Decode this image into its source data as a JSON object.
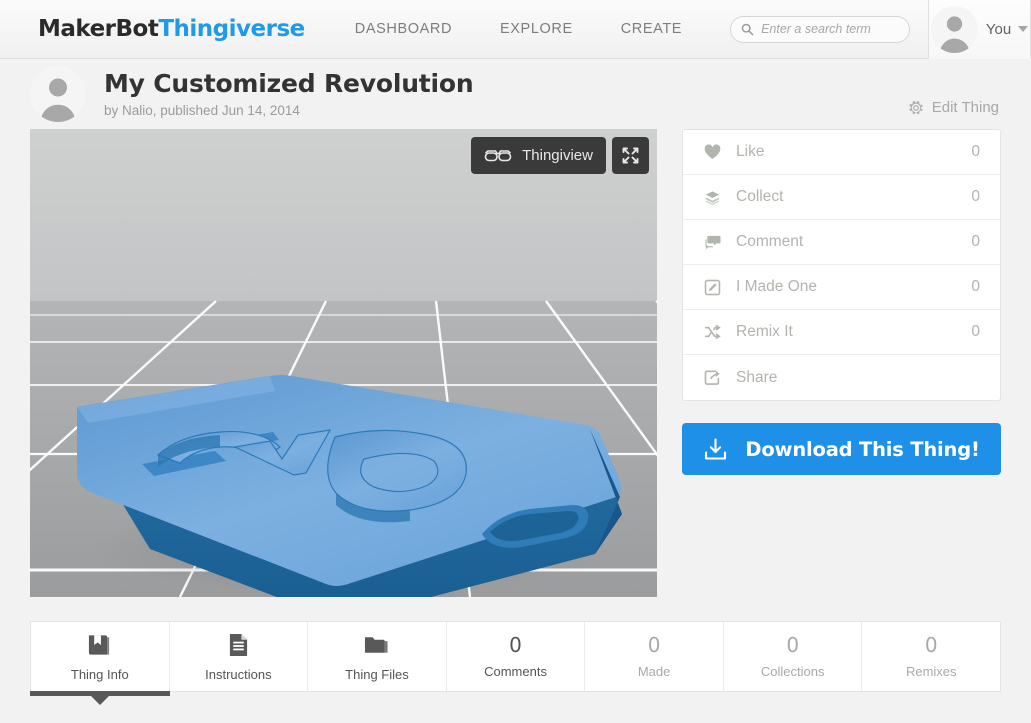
{
  "header": {
    "logo_primary": "MakerBot",
    "logo_secondary": "Thingiverse",
    "nav": [
      {
        "label": "DASHBOARD"
      },
      {
        "label": "EXPLORE"
      },
      {
        "label": "CREATE"
      }
    ],
    "search": {
      "placeholder": "Enter a search term",
      "value": "",
      "icon": "search-icon"
    },
    "user": {
      "name": "You",
      "avatar_icon": "avatar-placeholder-icon",
      "caret_icon": "chevron-down-icon"
    }
  },
  "thing": {
    "title": "My Customized Revolution",
    "byline": "by Nalio, published Jun 14, 2014",
    "avatar_icon": "avatar-placeholder-icon",
    "edit": {
      "label": "Edit Thing",
      "icon": "gear-icon"
    }
  },
  "viewer": {
    "toolbar": {
      "thingiview_label": "Thingiview",
      "glasses_icon": "3d-glasses-icon",
      "expand_icon": "fullscreen-expand-icon"
    },
    "scene": {
      "sky_color": "#c9caca",
      "floor_color": "#a5a6a7",
      "grid_color": "#ffffff",
      "model_top_color": "#6aa2d8",
      "model_side_color": "#1f6ba4",
      "model_edge_color": "#14517e"
    }
  },
  "actions": [
    {
      "label": "Like",
      "count": "0",
      "icon": "heart-icon"
    },
    {
      "label": "Collect",
      "count": "0",
      "icon": "box-icon"
    },
    {
      "label": "Comment",
      "count": "0",
      "icon": "comment-icon"
    },
    {
      "label": "I Made One",
      "count": "0",
      "icon": "pencil-square-icon"
    },
    {
      "label": "Remix It",
      "count": "0",
      "icon": "shuffle-icon"
    },
    {
      "label": "Share",
      "count": "",
      "icon": "share-icon"
    }
  ],
  "download": {
    "label": "Download This Thing!",
    "icon": "download-tray-icon",
    "color": "#1e90e8"
  },
  "tabs": [
    {
      "label": "Thing Info",
      "icon": "book-icon",
      "active": true
    },
    {
      "label": "Instructions",
      "icon": "document-icon",
      "active": false
    },
    {
      "label": "Thing Files",
      "icon": "folder-icon",
      "active": false
    },
    {
      "label": "Comments",
      "count": "0",
      "active": false,
      "emphasis": true
    },
    {
      "label": "Made",
      "count": "0",
      "active": false,
      "emphasis": false
    },
    {
      "label": "Collections",
      "count": "0",
      "active": false,
      "emphasis": false
    },
    {
      "label": "Remixes",
      "count": "0",
      "active": false,
      "emphasis": false
    }
  ]
}
